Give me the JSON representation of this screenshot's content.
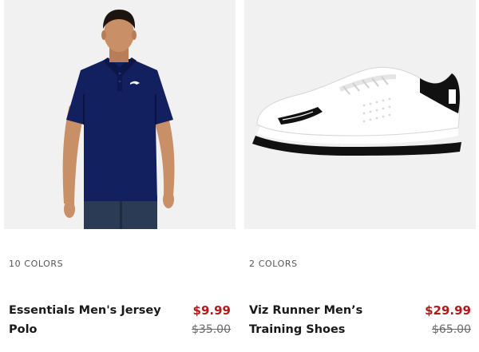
{
  "products": [
    {
      "colors_label": "10 COLORS",
      "name": "Essentials Men's Jersey Polo",
      "sale_price": "$9.99",
      "original_price": "$35.00",
      "image_icon": "navy-polo-shirt-model",
      "accent": "#0f1f5f"
    },
    {
      "colors_label": "2 COLORS",
      "name": "Viz Runner Men’s Training Shoes",
      "sale_price": "$29.99",
      "original_price": "$65.00",
      "image_icon": "white-black-training-shoe",
      "accent": "#000000"
    }
  ],
  "colors": {
    "sale": "#b01a1a",
    "original": "#6a6a6a",
    "image_bg": "#f1f1f1"
  }
}
